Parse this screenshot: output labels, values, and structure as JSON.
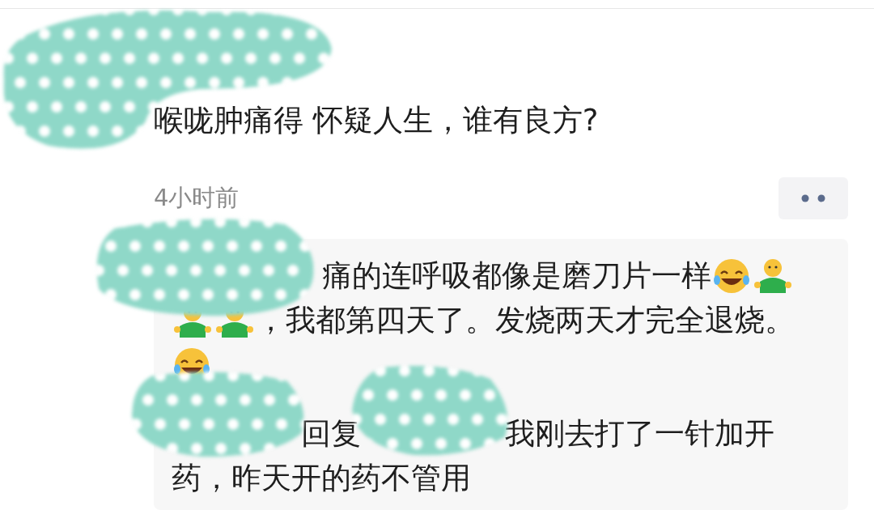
{
  "post": {
    "text": "喉咙肿痛得 怀疑人生，谁有良方?",
    "time": "4小时前"
  },
  "comments": [
    {
      "lines": [
        [
          {
            "kind": "text",
            "text": "痛的连呼吸都像是磨刀片一样"
          },
          {
            "kind": "laughing"
          },
          {
            "kind": "figure"
          }
        ],
        [
          {
            "kind": "figure"
          },
          {
            "kind": "figure"
          },
          {
            "kind": "text",
            "text": "，我都第四天了。发烧两天才完全退烧。"
          }
        ],
        [
          {
            "kind": "laughing"
          }
        ]
      ]
    },
    {
      "reply_label": "回复",
      "lines": [
        [
          {
            "kind": "text",
            "text": "我刚去打了一针加开"
          }
        ],
        [
          {
            "kind": "text",
            "text": "药，昨天开的药不管用"
          }
        ]
      ]
    }
  ]
}
